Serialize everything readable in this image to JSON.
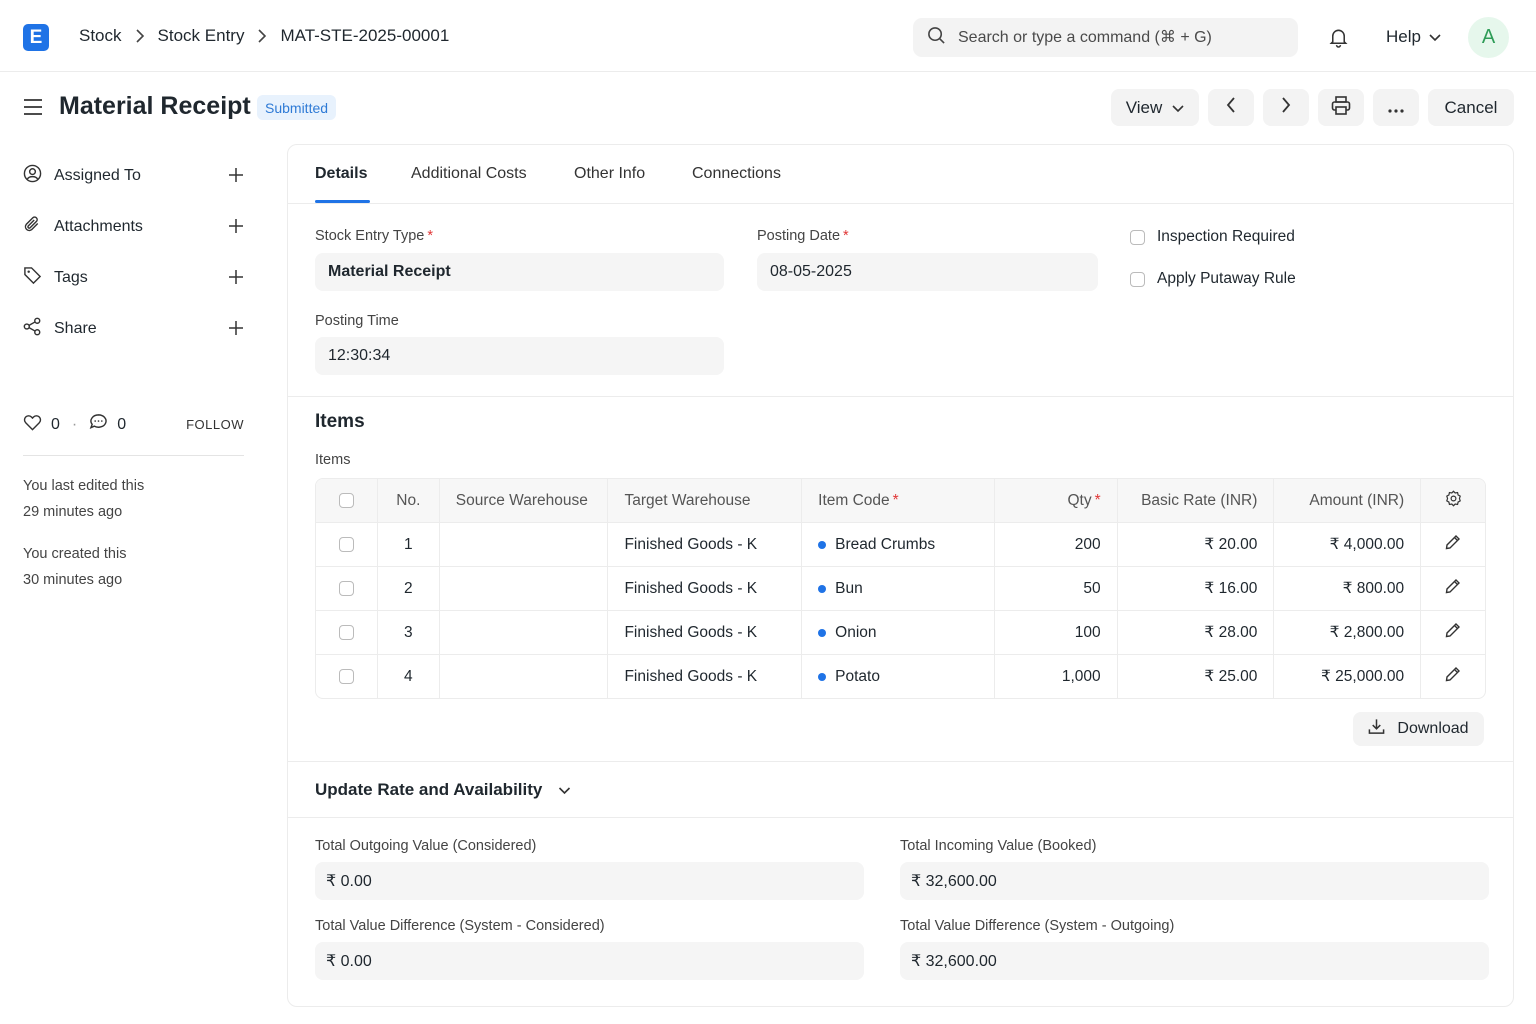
{
  "app": {
    "logo_letter": "E",
    "accent": "#1f73e6"
  },
  "breadcrumb": [
    "Stock",
    "Stock Entry",
    "MAT-STE-2025-00001"
  ],
  "search": {
    "placeholder": "Search or type a command (⌘ + G)"
  },
  "help_label": "Help",
  "user_initial": "A",
  "page": {
    "title": "Material Receipt",
    "status": "Submitted"
  },
  "header_buttons": {
    "view": "View",
    "cancel": "Cancel"
  },
  "sidebar": {
    "items": [
      {
        "label": "Assigned To",
        "icon": "user-circle-icon"
      },
      {
        "label": "Attachments",
        "icon": "paperclip-icon"
      },
      {
        "label": "Tags",
        "icon": "tag-icon"
      },
      {
        "label": "Share",
        "icon": "share-icon"
      }
    ],
    "likes": "0",
    "comments": "0",
    "follow": "FOLLOW",
    "notes": [
      {
        "line1": "You last edited this",
        "line2": "29 minutes ago"
      },
      {
        "line1": "You created this",
        "line2": "30 minutes ago"
      }
    ]
  },
  "tabs": [
    "Details",
    "Additional Costs",
    "Other Info",
    "Connections"
  ],
  "form": {
    "stock_entry_type": {
      "label": "Stock Entry Type",
      "value": "Material Receipt"
    },
    "posting_date": {
      "label": "Posting Date",
      "value": "08-05-2025"
    },
    "posting_time": {
      "label": "Posting Time",
      "value": "12:30:34"
    },
    "inspection_required": "Inspection Required",
    "apply_putaway_rule": "Apply Putaway Rule"
  },
  "items_section": {
    "title": "Items",
    "subtitle": "Items",
    "columns": {
      "no": "No.",
      "source": "Source Warehouse",
      "target": "Target Warehouse",
      "item_code": "Item Code",
      "qty": "Qty",
      "rate": "Basic Rate (INR)",
      "amount": "Amount (INR)"
    },
    "rows": [
      {
        "no": "1",
        "source": "",
        "target": "Finished Goods - K",
        "item": "Bread Crumbs",
        "qty": "200",
        "rate": "₹ 20.00",
        "amount": "₹ 4,000.00"
      },
      {
        "no": "2",
        "source": "",
        "target": "Finished Goods - K",
        "item": "Bun",
        "qty": "50",
        "rate": "₹ 16.00",
        "amount": "₹ 800.00"
      },
      {
        "no": "3",
        "source": "",
        "target": "Finished Goods - K",
        "item": "Onion",
        "qty": "100",
        "rate": "₹ 28.00",
        "amount": "₹ 2,800.00"
      },
      {
        "no": "4",
        "source": "",
        "target": "Finished Goods - K",
        "item": "Potato",
        "qty": "1,000",
        "rate": "₹ 25.00",
        "amount": "₹ 25,000.00"
      }
    ],
    "download": "Download"
  },
  "update_section": {
    "title": "Update Rate and Availability"
  },
  "totals": {
    "outgoing": {
      "label": "Total Outgoing Value (Considered)",
      "value": "₹ 0.00"
    },
    "incoming": {
      "label": "Total Incoming Value (Booked)",
      "value": "₹ 32,600.00"
    },
    "diff_considered": {
      "label": "Total Value Difference (System - Considered)",
      "value": "₹ 0.00"
    },
    "diff_outgoing": {
      "label": "Total Value Difference (System - Outgoing)",
      "value": "₹ 32,600.00"
    }
  }
}
